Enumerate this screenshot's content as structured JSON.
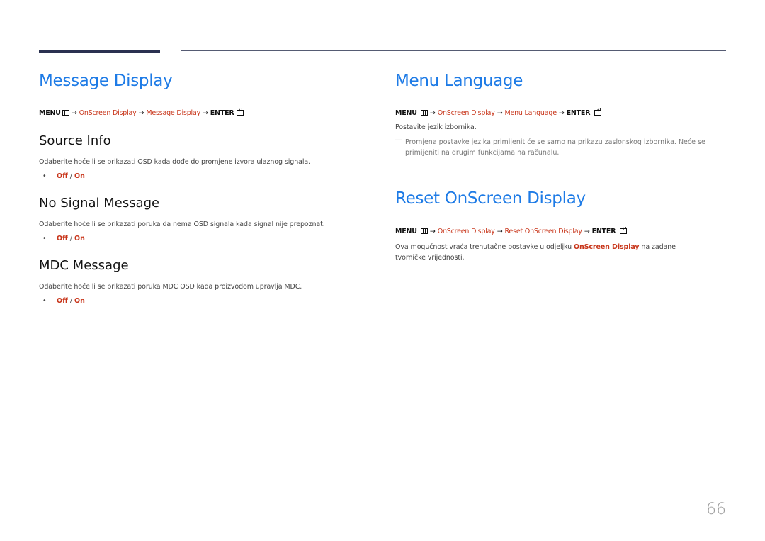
{
  "left": {
    "title": "Message Display",
    "path": {
      "menu": "MENU",
      "items": [
        "OnScreen Display",
        "Message Display"
      ],
      "enter": "ENTER",
      "arrow": "→"
    },
    "sections": [
      {
        "heading": "Source Info",
        "description": "Odaberite hoće li se prikazati OSD kada dođe do promjene izvora ulaznog signala.",
        "options": {
          "off": "Off",
          "sep": " / ",
          "on": "On"
        }
      },
      {
        "heading": "No Signal Message",
        "description": "Odaberite hoće li se prikazati poruka da nema OSD signala kada signal nije prepoznat.",
        "options": {
          "off": "Off",
          "sep": " / ",
          "on": "On"
        }
      },
      {
        "heading": "MDC Message",
        "description": "Odaberite hoće li se prikazati poruka MDC OSD kada proizvodom upravlja MDC.",
        "options": {
          "off": "Off",
          "sep": " / ",
          "on": "On"
        }
      }
    ]
  },
  "right": {
    "menu_language": {
      "title": "Menu Language",
      "path": {
        "menu": "MENU",
        "items": [
          "OnScreen Display",
          "Menu Language"
        ],
        "enter": "ENTER",
        "arrow": "→"
      },
      "description": "Postavite jezik izbornika.",
      "note_dash": "―",
      "note": "Promjena postavke jezika primijenit će se samo na prikazu zaslonskog izbornika. Neće se primijeniti na drugim funkcijama na računalu."
    },
    "reset": {
      "title": "Reset OnScreen Display",
      "path": {
        "menu": "MENU",
        "items": [
          "OnScreen Display",
          "Reset OnScreen Display"
        ],
        "enter": "ENTER",
        "arrow": "→"
      },
      "desc_before": "Ova mogućnost vraća trenutačne postavke u odjeljku ",
      "desc_highlight": "OnScreen Display",
      "desc_after": " na zadane tvorničke vrijednosti."
    }
  },
  "page_number": "66",
  "colors": {
    "title_blue": "#1e7be6",
    "accent_red": "#c8351a",
    "bar_navy": "#2a3150"
  }
}
